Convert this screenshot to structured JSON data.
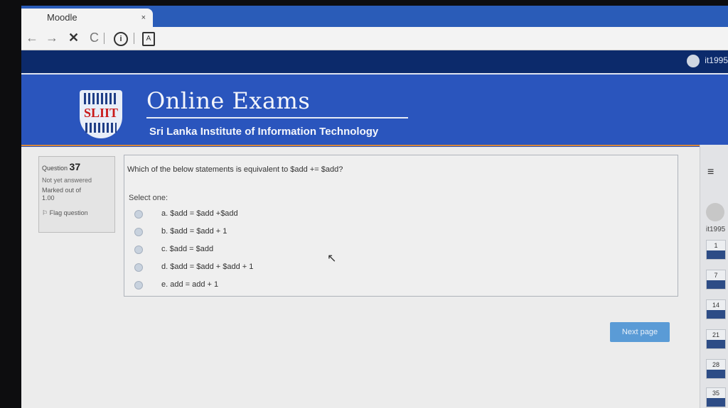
{
  "browser": {
    "tab_title": "Moodle",
    "tab_close": "×",
    "nav": {
      "back": "←",
      "forward": "→",
      "stop": "✕",
      "reload": "C",
      "info": "i",
      "page_icon": "A"
    }
  },
  "navbar": {
    "user": "it1995"
  },
  "banner": {
    "logo_text": "SLIIT",
    "title": "Online Exams",
    "subtitle": "Sri Lanka Institute of Information Technology"
  },
  "question_info": {
    "label": "Question",
    "number": "37",
    "state": "Not yet answered",
    "marked": "Marked out of",
    "mark_value": "1.00",
    "flag": "Flag question"
  },
  "question": {
    "text": "Which of the below statements is equivalent to $add += $add?",
    "select_one": "Select one:",
    "options": [
      {
        "label": "a. $add = $add +$add"
      },
      {
        "label": "b. $add = $add + 1"
      },
      {
        "label": "c. $add = $add"
      },
      {
        "label": "d. $add = $add + $add + 1"
      },
      {
        "label": "e. add = add + 1"
      }
    ]
  },
  "next_page": "Next page",
  "right_panel": {
    "menu_icon": "≡",
    "user": "it1995",
    "nav_numbers": [
      "1",
      "7",
      "14",
      "21",
      "28",
      "35"
    ]
  }
}
